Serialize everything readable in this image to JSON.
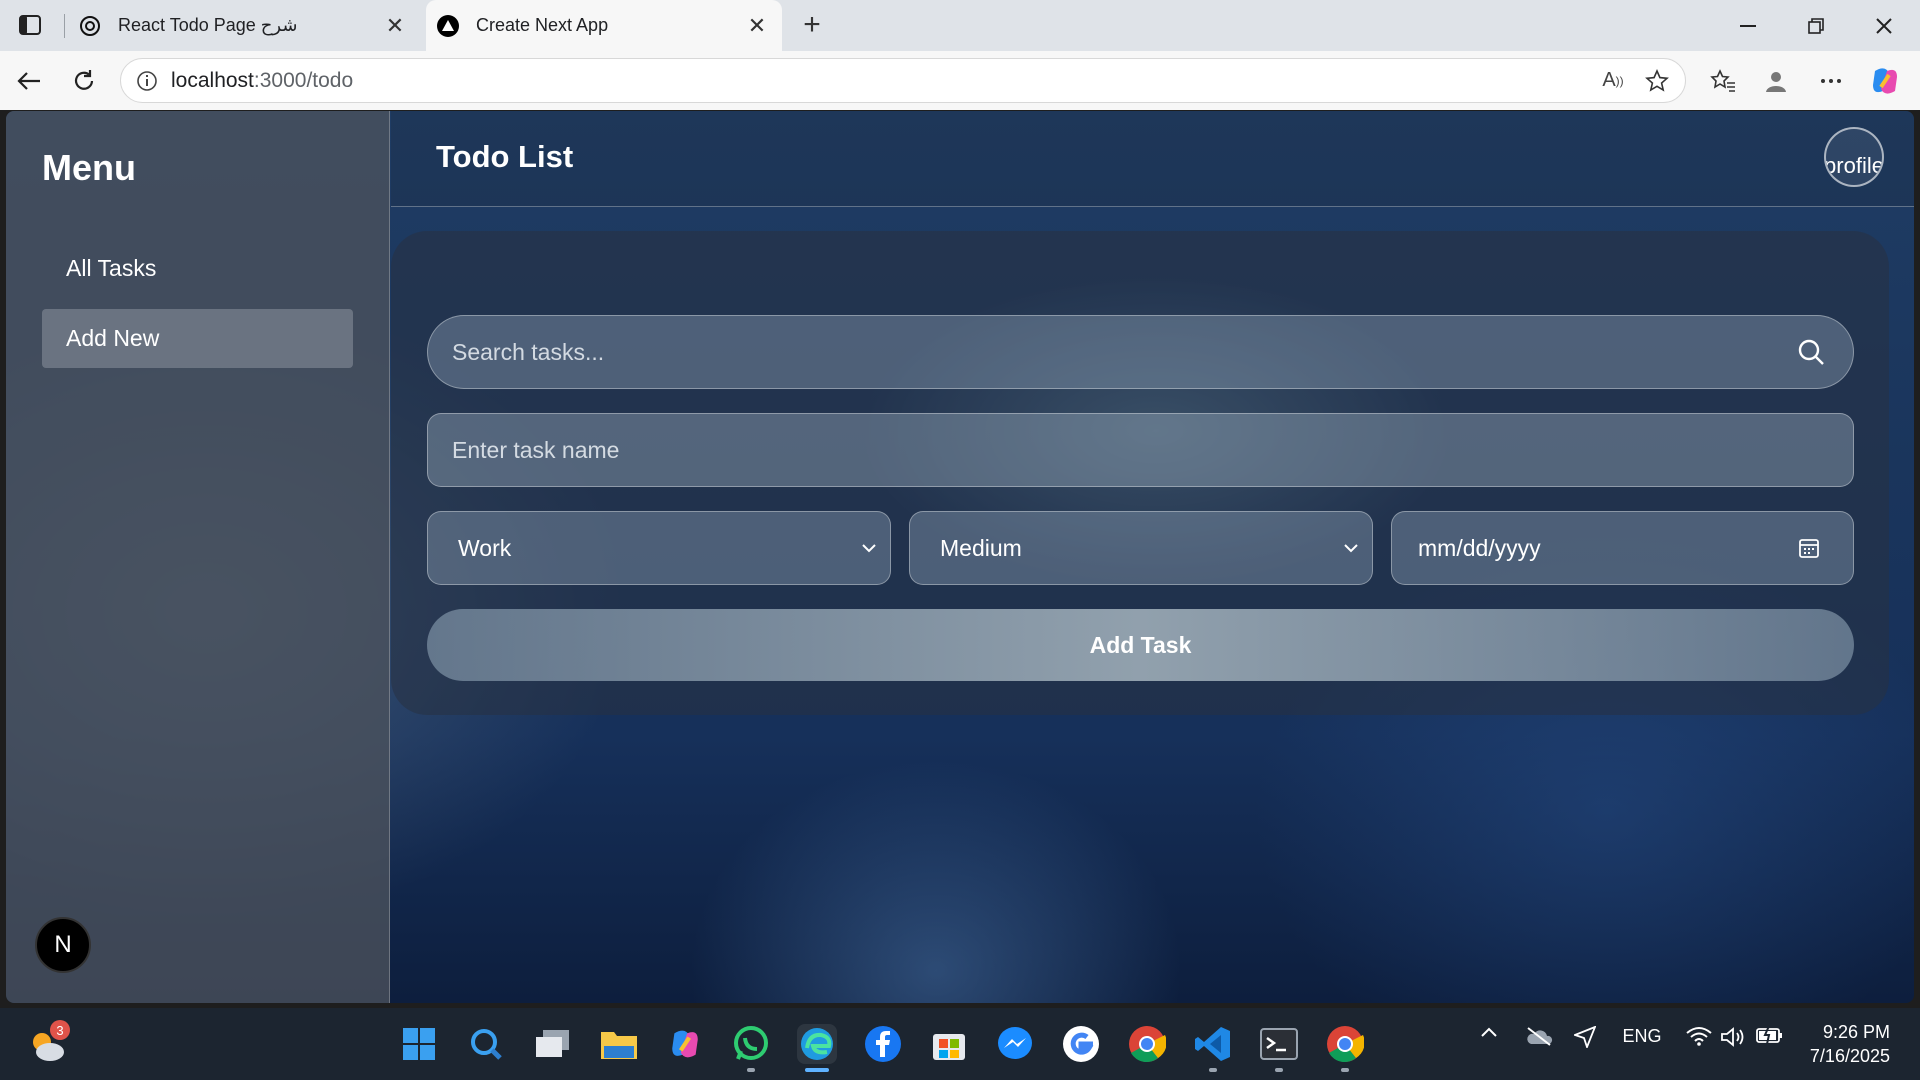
{
  "browser": {
    "tabs": [
      {
        "title": "React Todo Page شرح",
        "active": false,
        "icon": "openai-icon"
      },
      {
        "title": "Create Next App",
        "active": true,
        "icon": "nextjs-icon"
      }
    ],
    "address": {
      "host": "localhost",
      "path": ":3000/todo"
    }
  },
  "sidebar": {
    "title": "Menu",
    "items": [
      {
        "label": "All Tasks",
        "active": false
      },
      {
        "label": "Add New",
        "active": true
      }
    ],
    "badge_letter": "N"
  },
  "header": {
    "title": "Todo List",
    "avatar_alt": "profile"
  },
  "form": {
    "search_placeholder": "Search tasks...",
    "task_placeholder": "Enter task name",
    "category": {
      "selected": "Work"
    },
    "priority": {
      "selected": "Medium"
    },
    "date_placeholder": "mm/dd/yyyy",
    "add_button": "Add Task"
  },
  "taskbar": {
    "weather_badge": "3",
    "language": "ENG",
    "time": "9:26 PM",
    "date": "7/16/2025"
  },
  "colors": {
    "accent_active_taskbar": "#5fb2ff",
    "sidebar_bg": "#4b525c",
    "notification_badge": "#e0534a"
  }
}
